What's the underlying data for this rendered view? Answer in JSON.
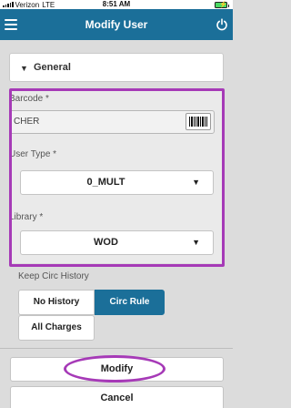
{
  "status_bar": {
    "carrier": "Verizon",
    "network": "LTE",
    "time": "8:51 AM"
  },
  "header": {
    "title": "Modify User"
  },
  "section": {
    "title": "General"
  },
  "form": {
    "barcode_label": "Barcode *",
    "barcode_value": "CHER",
    "user_type_label": "User Type *",
    "user_type_value": "0_MULT",
    "library_label": "Library *",
    "library_value": "WOD"
  },
  "circ_history": {
    "label": "Keep Circ History",
    "options": [
      "No History",
      "Circ Rule",
      "All Charges"
    ],
    "selected": "Circ Rule"
  },
  "actions": {
    "modify": "Modify",
    "cancel": "Cancel"
  },
  "colors": {
    "header": "#1b6f99",
    "selected": "#1b6f99",
    "annotation": "#a63ab7",
    "battery": "#4cd964"
  }
}
